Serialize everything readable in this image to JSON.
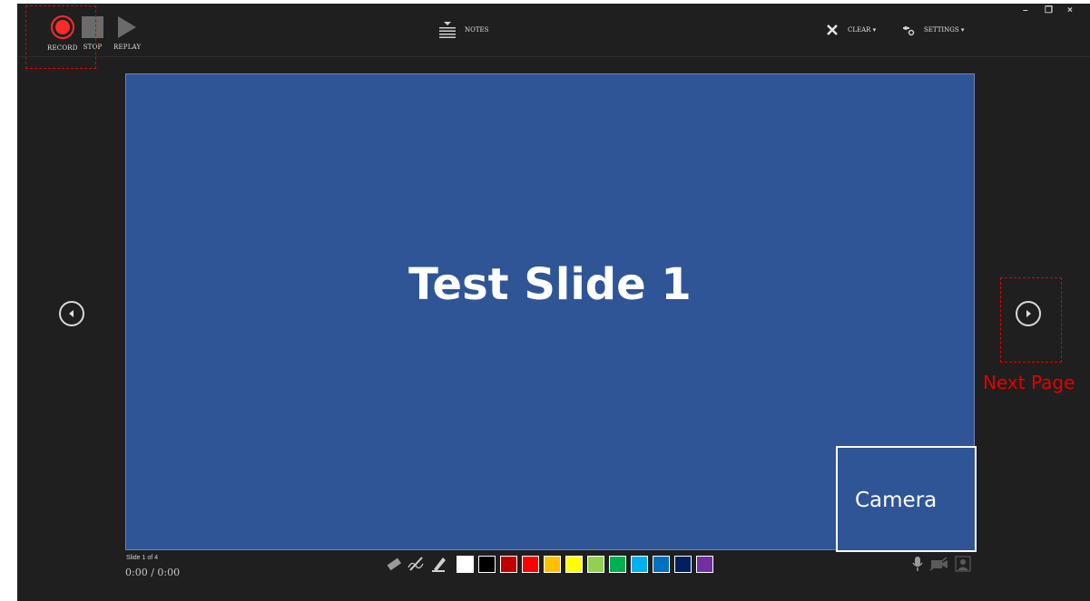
{
  "toolbar": {
    "record_label": "RECORD",
    "stop_label": "STOP",
    "replay_label": "REPLAY",
    "notes_label": "NOTES",
    "clear_label": "CLEAR ▾",
    "settings_label": "SETTINGS ▾",
    "icons": [
      "record-icon",
      "stop-icon",
      "replay-icon",
      "notes-icon",
      "clear-icon",
      "settings-icon"
    ]
  },
  "window_controls": {
    "minimize": "–",
    "restore": "❐",
    "close": "×"
  },
  "slide": {
    "title": "Test Slide 1",
    "background": "#2f5597",
    "counter": "Slide 1 of 4"
  },
  "camera": {
    "label": "Camera"
  },
  "navigation": {
    "next_annotation": "Next Page"
  },
  "timer": {
    "text": "0:00 / 0:00"
  },
  "pen_tools": [
    "eraser-icon",
    "pen-icon",
    "highlighter-icon"
  ],
  "palette": [
    "#ffffff",
    "#000000",
    "#c00000",
    "#ff0000",
    "#ffc000",
    "#ffff00",
    "#92d050",
    "#00b050",
    "#00b0f0",
    "#0070c0",
    "#002060",
    "#7030a0"
  ],
  "media_controls": [
    "microphone-icon",
    "camera-off-icon",
    "camera-preview-icon"
  ],
  "colors": {
    "background": "#1f1f1f",
    "record_red": "#ff2b2b",
    "annotation_red": "#e30000"
  }
}
